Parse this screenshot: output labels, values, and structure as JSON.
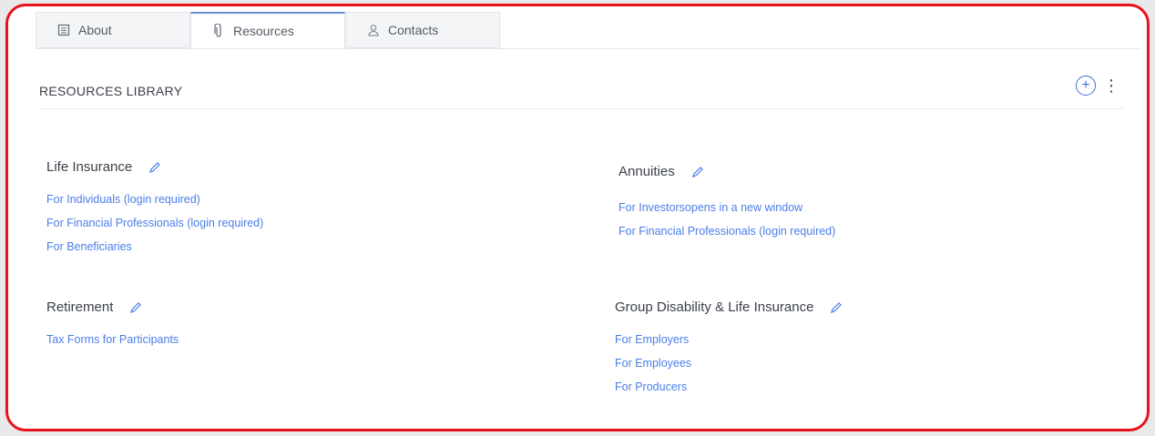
{
  "tabs": [
    {
      "label": "About",
      "icon": "building-icon"
    },
    {
      "label": "Resources",
      "icon": "paperclip-icon",
      "active": true
    },
    {
      "label": "Contacts",
      "icon": "person-icon"
    }
  ],
  "library": {
    "title": "RESOURCES LIBRARY",
    "add_icon": "plus-circle-icon",
    "more_icon": "kebab-icon"
  },
  "sections": {
    "life": {
      "title": "Life Insurance",
      "links": [
        "For Individuals (login required)",
        "For Financial Professionals (login required)",
        "For Beneficiaries"
      ]
    },
    "annuities": {
      "title": "Annuities",
      "links": [
        "For Investorsopens in a new window",
        "For Financial Professionals (login required)"
      ]
    },
    "retirement": {
      "title": "Retirement",
      "links": [
        "Tax Forms for Participants"
      ]
    },
    "group": {
      "title": "Group Disability & Life Insurance",
      "links": [
        "For Employers",
        "For Employees",
        "For Producers"
      ]
    }
  },
  "colors": {
    "accent": "#4b7ee8",
    "frame": "#e8131a"
  }
}
